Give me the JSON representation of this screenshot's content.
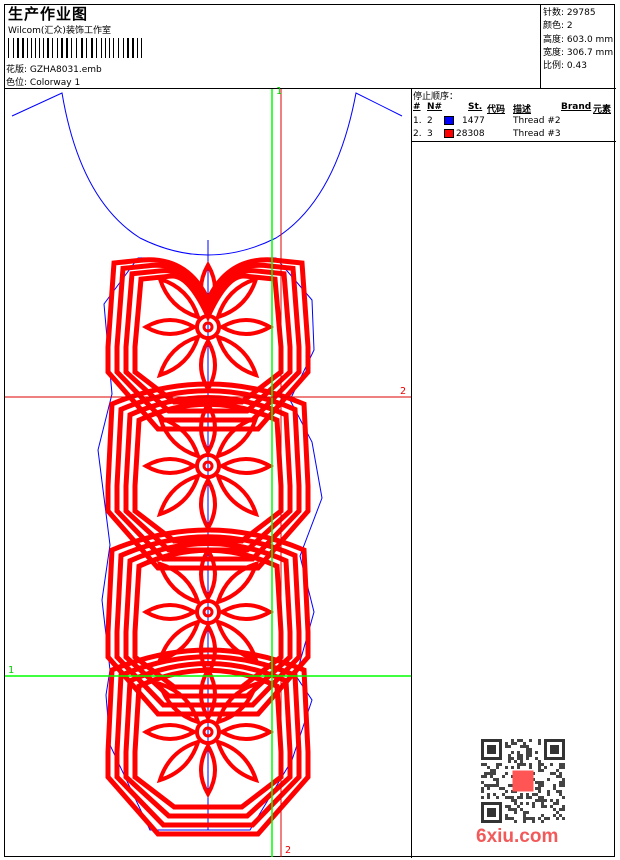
{
  "header": {
    "title": "生产作业图",
    "company": "Wilcom(汇众)装饰工作室",
    "design_label": "花版:",
    "design_value": "GZHA8031.emb",
    "colorway_label": "色位:",
    "colorway_value": "Colorway 1"
  },
  "stats": [
    {
      "label": "针数:",
      "value": "29785"
    },
    {
      "label": "颜色:",
      "value": "2"
    },
    {
      "label": "高度:",
      "value": "603.0 mm"
    },
    {
      "label": "宽度:",
      "value": "306.7 mm"
    },
    {
      "label": "比例:",
      "value": "0.43"
    }
  ],
  "stop_sequence": {
    "title": "停止顺序：",
    "columns": [
      "#",
      "N#",
      "St.",
      "代码",
      "描述",
      "Brand",
      "元素"
    ],
    "rows": [
      {
        "index": "1.",
        "n": "2",
        "color": "#0000ff",
        "stitches": "1477",
        "desc": "Thread #2"
      },
      {
        "index": "2.",
        "n": "3",
        "color": "#ff0000",
        "stitches": "28308",
        "desc": "Thread #3"
      }
    ]
  },
  "markers": {
    "v1": "1",
    "h2": "2",
    "h1": "1",
    "v2": "2"
  },
  "colors": {
    "thread_red": "#ff0000",
    "thread_blue": "#0000ff",
    "guide_green": "#00ff00"
  },
  "watermark": "6xiu.com"
}
